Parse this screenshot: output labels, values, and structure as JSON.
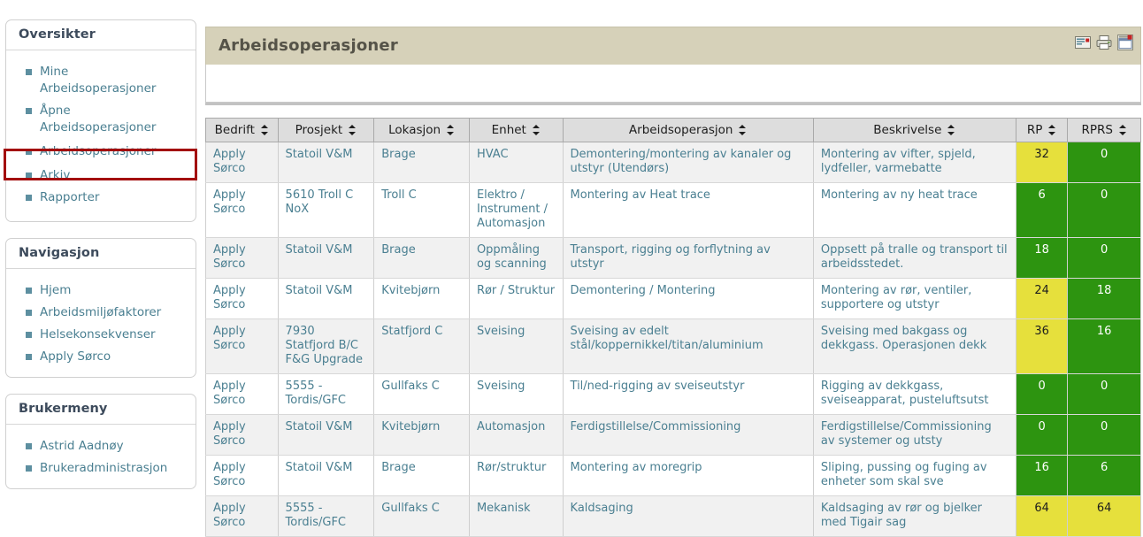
{
  "sidebar": {
    "panels": [
      {
        "title": "Oversikter",
        "items": [
          {
            "label": "Mine Arbeidsoperasjoner"
          },
          {
            "label": "Åpne Arbeidsoperasjoner"
          },
          {
            "label": "Arbeidsoperasjoner"
          },
          {
            "label": "Arkiv"
          },
          {
            "label": "Rapporter"
          }
        ]
      },
      {
        "title": "Navigasjon",
        "items": [
          {
            "label": "Hjem"
          },
          {
            "label": "Arbeidsmiljøfaktorer"
          },
          {
            "label": "Helsekonsekvenser"
          },
          {
            "label": "Apply Sørco"
          }
        ]
      },
      {
        "title": "Brukermeny",
        "items": [
          {
            "label": "Astrid Aadnøy"
          },
          {
            "label": "Brukeradministrasjon"
          }
        ]
      }
    ],
    "highlight_color": "#a30d0d"
  },
  "content": {
    "title": "Arbeidsoperasjoner",
    "header_bg": "#d6d1b9",
    "icons": [
      {
        "name": "email-export-icon"
      },
      {
        "name": "printer-icon"
      },
      {
        "name": "window-export-icon"
      }
    ],
    "filter_panel_text": ""
  },
  "table": {
    "columns": [
      {
        "key": "bedrift",
        "label": "Bedrift",
        "sortable": true
      },
      {
        "key": "prosjekt",
        "label": "Prosjekt",
        "sortable": true
      },
      {
        "key": "lokasjon",
        "label": "Lokasjon",
        "sortable": true
      },
      {
        "key": "enhet",
        "label": "Enhet",
        "sortable": true
      },
      {
        "key": "arbeidsoperasjon",
        "label": "Arbeidsoperasjon",
        "sortable": true
      },
      {
        "key": "beskrivelse",
        "label": "Beskrivelse",
        "sortable": true
      },
      {
        "key": "rp",
        "label": "RP",
        "sortable": true
      },
      {
        "key": "rprs",
        "label": "RPRS",
        "sortable": true
      }
    ],
    "colors": {
      "green": "#2d9410",
      "yellow": "#e6e03c"
    },
    "rows": [
      {
        "bedrift": "Apply Sørco",
        "prosjekt": "Statoil V&M",
        "lokasjon": "Brage",
        "enhet": "HVAC",
        "arbeidsoperasjon": "Demontering/montering av kanaler og utstyr (Utendørs)",
        "beskrivelse": "Montering av vifter, spjeld, lydfeller, varmebatte",
        "rp": "32",
        "rp_color": "yellow",
        "rprs": "0",
        "rprs_color": "green"
      },
      {
        "bedrift": "Apply Sørco",
        "prosjekt": "5610 Troll C NoX",
        "lokasjon": "Troll C",
        "enhet": "Elektro / Instrument / Automasjon",
        "arbeidsoperasjon": "Montering av Heat trace",
        "beskrivelse": "Montering av ny heat trace",
        "rp": "6",
        "rp_color": "green",
        "rprs": "0",
        "rprs_color": "green"
      },
      {
        "bedrift": "Apply Sørco",
        "prosjekt": "Statoil V&M",
        "lokasjon": "Brage",
        "enhet": "Oppmåling og scanning",
        "arbeidsoperasjon": "Transport, rigging og forflytning av utstyr",
        "beskrivelse": "Oppsett på tralle og transport til arbeidsstedet.",
        "rp": "18",
        "rp_color": "green",
        "rprs": "0",
        "rprs_color": "green"
      },
      {
        "bedrift": "Apply Sørco",
        "prosjekt": "Statoil V&M",
        "lokasjon": "Kvitebjørn",
        "enhet": "Rør / Struktur",
        "arbeidsoperasjon": "Demontering / Montering",
        "beskrivelse": "Montering av rør, ventiler, supportere og utstyr",
        "rp": "24",
        "rp_color": "yellow",
        "rprs": "18",
        "rprs_color": "green"
      },
      {
        "bedrift": "Apply Sørco",
        "prosjekt": "7930 Statfjord B/C F&G Upgrade",
        "lokasjon": "Statfjord C",
        "enhet": "Sveising",
        "arbeidsoperasjon": "Sveising av edelt stål/koppernikkel/titan/aluminium",
        "beskrivelse": "Sveising med bakgass og dekkgass. Operasjonen dekk",
        "rp": "36",
        "rp_color": "yellow",
        "rprs": "16",
        "rprs_color": "green"
      },
      {
        "bedrift": "Apply Sørco",
        "prosjekt": "5555 - Tordis/GFC",
        "lokasjon": "Gullfaks C",
        "enhet": "Sveising",
        "arbeidsoperasjon": "Til/ned-rigging av sveiseutstyr",
        "beskrivelse": "Rigging av dekkgass, sveiseapparat, pusteluftsutst",
        "rp": "0",
        "rp_color": "green",
        "rprs": "0",
        "rprs_color": "green"
      },
      {
        "bedrift": "Apply Sørco",
        "prosjekt": "Statoil V&M",
        "lokasjon": "Kvitebjørn",
        "enhet": "Automasjon",
        "arbeidsoperasjon": "Ferdigstillelse/Commissioning",
        "beskrivelse": "Ferdigstillelse/Commissioning av systemer og utsty",
        "rp": "0",
        "rp_color": "green",
        "rprs": "0",
        "rprs_color": "green"
      },
      {
        "bedrift": "Apply Sørco",
        "prosjekt": "Statoil V&M",
        "lokasjon": "Brage",
        "enhet": "Rør/struktur",
        "arbeidsoperasjon": "Montering av moregrip",
        "beskrivelse": "Sliping, pussing og fuging av enheter som skal sve",
        "rp": "16",
        "rp_color": "green",
        "rprs": "6",
        "rprs_color": "green"
      },
      {
        "bedrift": "Apply Sørco",
        "prosjekt": "5555 - Tordis/GFC",
        "lokasjon": "Gullfaks C",
        "enhet": "Mekanisk",
        "arbeidsoperasjon": "Kaldsaging",
        "beskrivelse": "Kaldsaging av rør og bjelker med Tigair sag",
        "rp": "64",
        "rp_color": "yellow",
        "rprs": "64",
        "rprs_color": "yellow"
      }
    ]
  }
}
